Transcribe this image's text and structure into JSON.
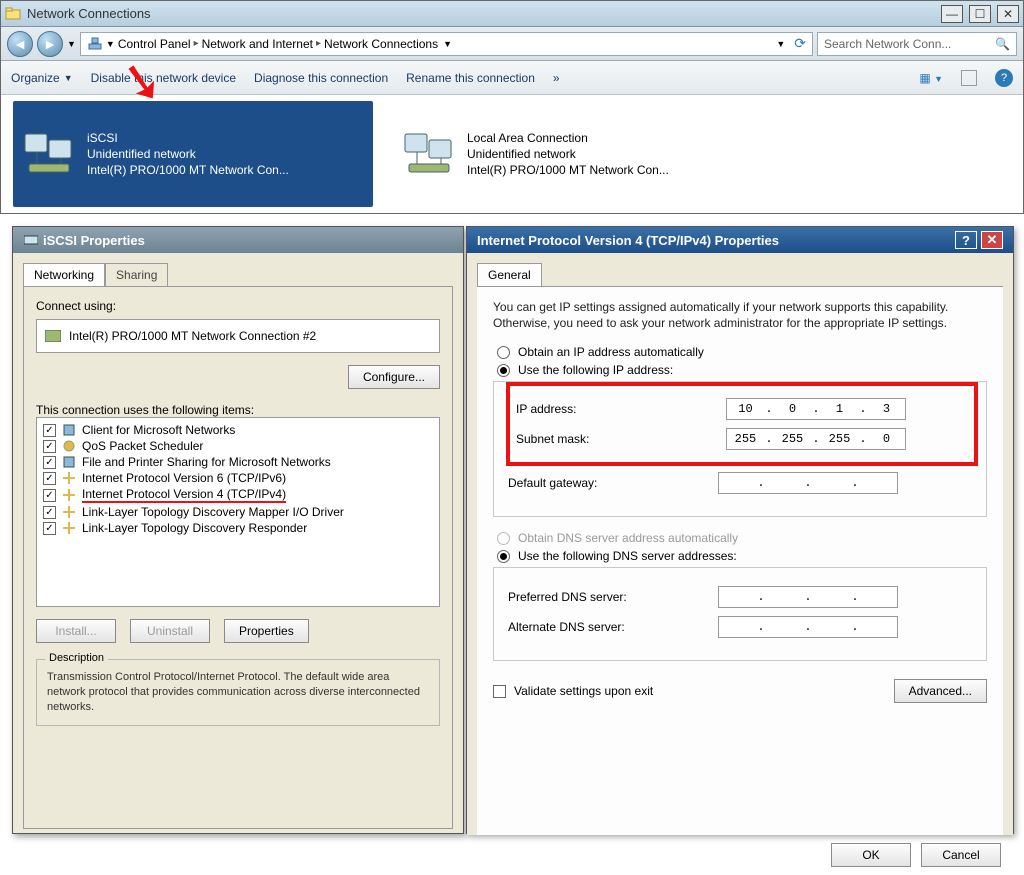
{
  "window": {
    "title": "Network Connections",
    "breadcrumb": [
      "Control Panel",
      "Network and Internet",
      "Network Connections"
    ],
    "search_placeholder": "Search Network Conn..."
  },
  "cmdbar": {
    "organize": "Organize",
    "disable": "Disable this network device",
    "diagnose": "Diagnose this connection",
    "rename": "Rename this connection",
    "overflow": "»"
  },
  "connections": [
    {
      "name": "iSCSI",
      "status": "Unidentified network",
      "adapter": "Intel(R) PRO/1000 MT Network Con...",
      "selected": true
    },
    {
      "name": "Local Area Connection",
      "status": "Unidentified network",
      "adapter": "Intel(R) PRO/1000 MT Network Con...",
      "selected": false
    }
  ],
  "iscsi_dlg": {
    "title": "iSCSI Properties",
    "tabs": [
      "Networking",
      "Sharing"
    ],
    "connect_label": "Connect using:",
    "adapter": "Intel(R) PRO/1000 MT Network Connection #2",
    "configure_btn": "Configure...",
    "items_label": "This connection uses the following items:",
    "items": [
      "Client for Microsoft Networks",
      "QoS Packet Scheduler",
      "File and Printer Sharing for Microsoft Networks",
      "Internet Protocol Version 6 (TCP/IPv6)",
      "Internet Protocol Version 4 (TCP/IPv4)",
      "Link-Layer Topology Discovery Mapper I/O Driver",
      "Link-Layer Topology Discovery Responder"
    ],
    "btn_install": "Install...",
    "btn_uninstall": "Uninstall",
    "btn_properties": "Properties",
    "desc_title": "Description",
    "desc_text": "Transmission Control Protocol/Internet Protocol. The default wide area network protocol that provides communication across diverse interconnected networks."
  },
  "ipv4_dlg": {
    "title": "Internet Protocol Version 4 (TCP/IPv4) Properties",
    "tab": "General",
    "note": "You can get IP settings assigned automatically if your network supports this capability. Otherwise, you need to ask your network administrator for the appropriate IP settings.",
    "radio_auto": "Obtain an IP address automatically",
    "radio_manual": "Use the following IP address:",
    "ip_label": "IP address:",
    "ip": [
      "10",
      "0",
      "1",
      "3"
    ],
    "mask_label": "Subnet mask:",
    "mask": [
      "255",
      "255",
      "255",
      "0"
    ],
    "gw_label": "Default gateway:",
    "gw": [
      "",
      "",
      "",
      ""
    ],
    "dns_auto": "Obtain DNS server address automatically",
    "dns_manual": "Use the following DNS server addresses:",
    "pdns_label": "Preferred DNS server:",
    "pdns": [
      "",
      "",
      "",
      ""
    ],
    "adns_label": "Alternate DNS server:",
    "adns": [
      "",
      "",
      "",
      ""
    ],
    "validate": "Validate settings upon exit",
    "advanced": "Advanced...",
    "ok": "OK",
    "cancel": "Cancel"
  }
}
